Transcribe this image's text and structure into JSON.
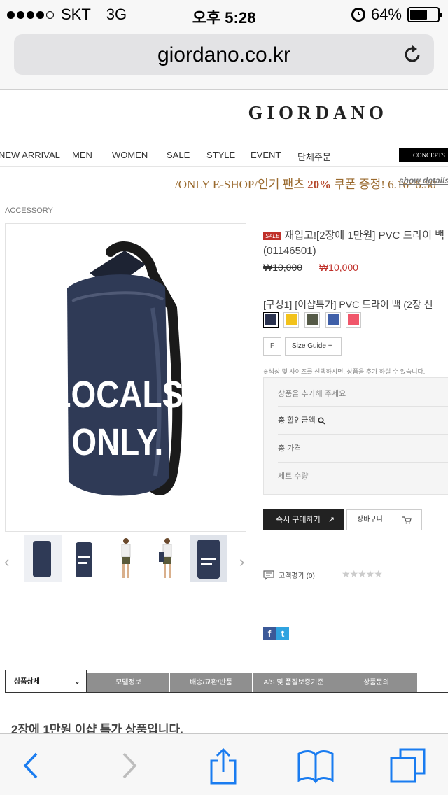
{
  "status_bar": {
    "carrier": "SKT",
    "network": "3G",
    "time": "오후 5:28",
    "battery": "64%",
    "battery_level": 0.64
  },
  "browser": {
    "url": "giordano.co.kr"
  },
  "site": {
    "logo": "GIORDANO",
    "nav": [
      "NEW ARRIVAL",
      "MEN",
      "WOMEN",
      "SALE",
      "STYLE",
      "EVENT",
      "단체주문"
    ],
    "concepts": "CONCEPTS",
    "promo": {
      "prefix": "/ONLY E-SHOP/인기 팬츠 ",
      "highlight": "20%",
      "suffix": " 쿠폰 증정! 6.16~6.30",
      "link": "show details"
    }
  },
  "breadcrumb": "ACCESSORY",
  "product": {
    "badge": "SALE",
    "title": "재입고![2장에 1만원] PVC 드라이 백",
    "code": "(01146501)",
    "original_price": "₩10,000",
    "sale_price": "₩10,000",
    "option_label": "[구성1] [이샵특가] PVC 드라이 백 (2장 선",
    "image_text_1": "LOCALS",
    "image_text_2": "ONLY.",
    "colors": [
      "#2b3350",
      "#f2c21b",
      "#565b48",
      "#3f5fa8",
      "#f0566a"
    ],
    "size": "F",
    "size_guide": "Size Guide +",
    "note": "※색상 및 사이즈를 선택하시면, 상품을 추가 하실 수 있습니다.",
    "summary": {
      "add_prompt": "상품을 추가해 주세요",
      "discount_label": "총 할인금액",
      "total_label": "총 가격",
      "set_qty_label": "세트 수량"
    },
    "buy_label": "즉시 구매하기",
    "cart_label": "장바구니",
    "review_label": "고객평가 (0)",
    "rating": 0
  },
  "tabs": [
    "상품상세",
    "모델정보",
    "배송/교환/반품",
    "A/S 및 품질보증기준",
    "상품문의"
  ],
  "description": "2장에 1만원 이샵 특가 상품입니다."
}
